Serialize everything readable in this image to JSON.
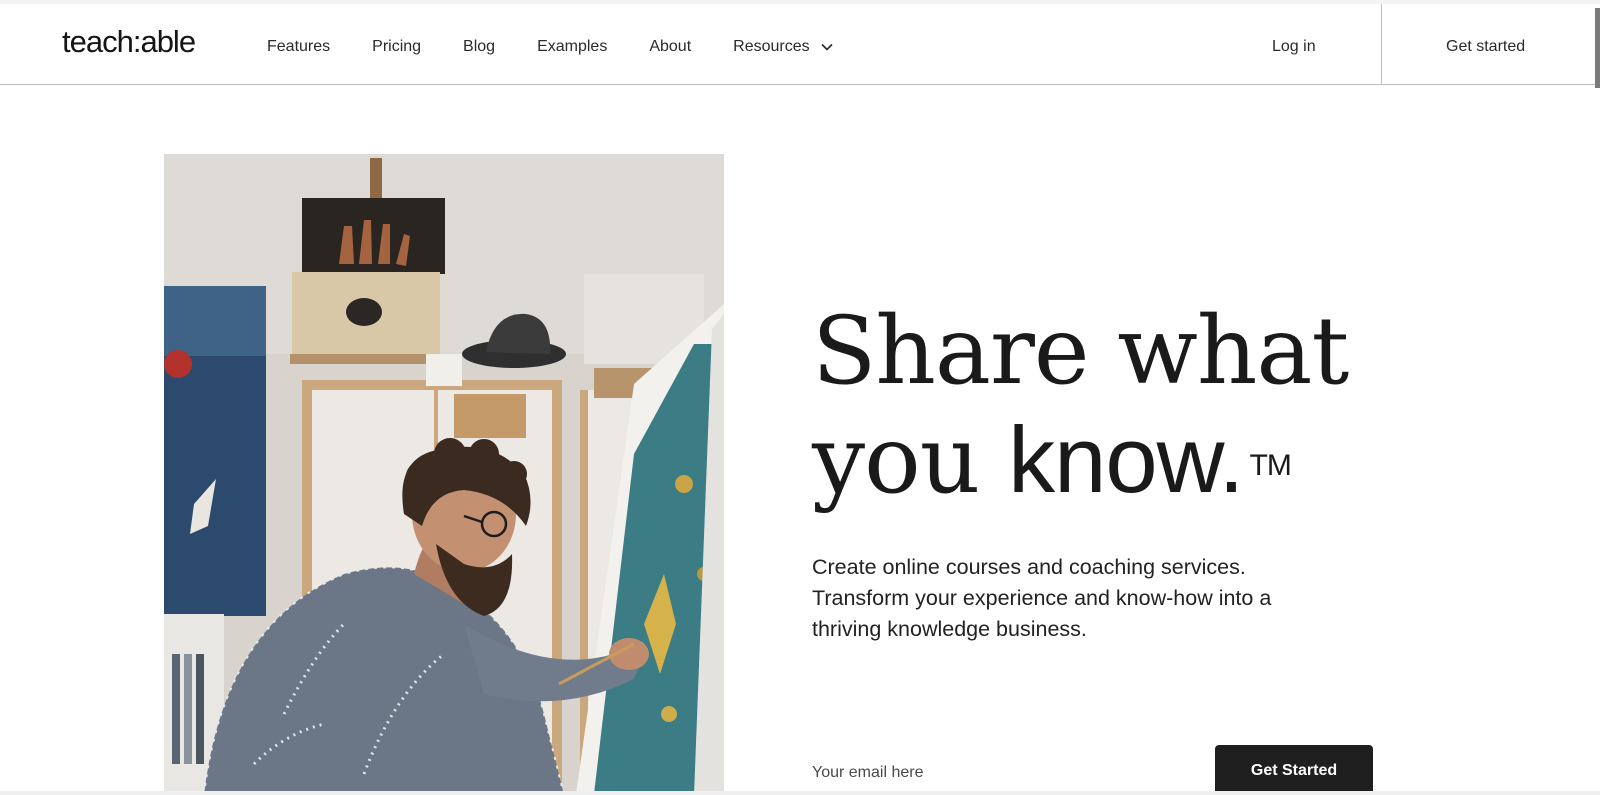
{
  "header": {
    "logo": "teach:able",
    "nav": [
      {
        "label": "Features"
      },
      {
        "label": "Pricing"
      },
      {
        "label": "Blog"
      },
      {
        "label": "Examples"
      },
      {
        "label": "About"
      },
      {
        "label": "Resources"
      }
    ],
    "login_label": "Log in",
    "get_started_label": "Get started"
  },
  "hero": {
    "headline_line1": "Share what",
    "headline_line2_a": "you ",
    "headline_line2_b": "know.",
    "trademark": "TM",
    "subtext": "Create online courses and coaching services. Transform your experience and know-how into a thriving knowledge business.",
    "email_placeholder": "Your email here",
    "cta_label": "Get Started"
  },
  "icons": {
    "resources_chevron": "chevron-down-icon"
  },
  "colors": {
    "text": "#1a1a1a",
    "cta_background": "#1f1f1f",
    "cta_text": "#ffffff",
    "border": "#bdbdbd"
  }
}
